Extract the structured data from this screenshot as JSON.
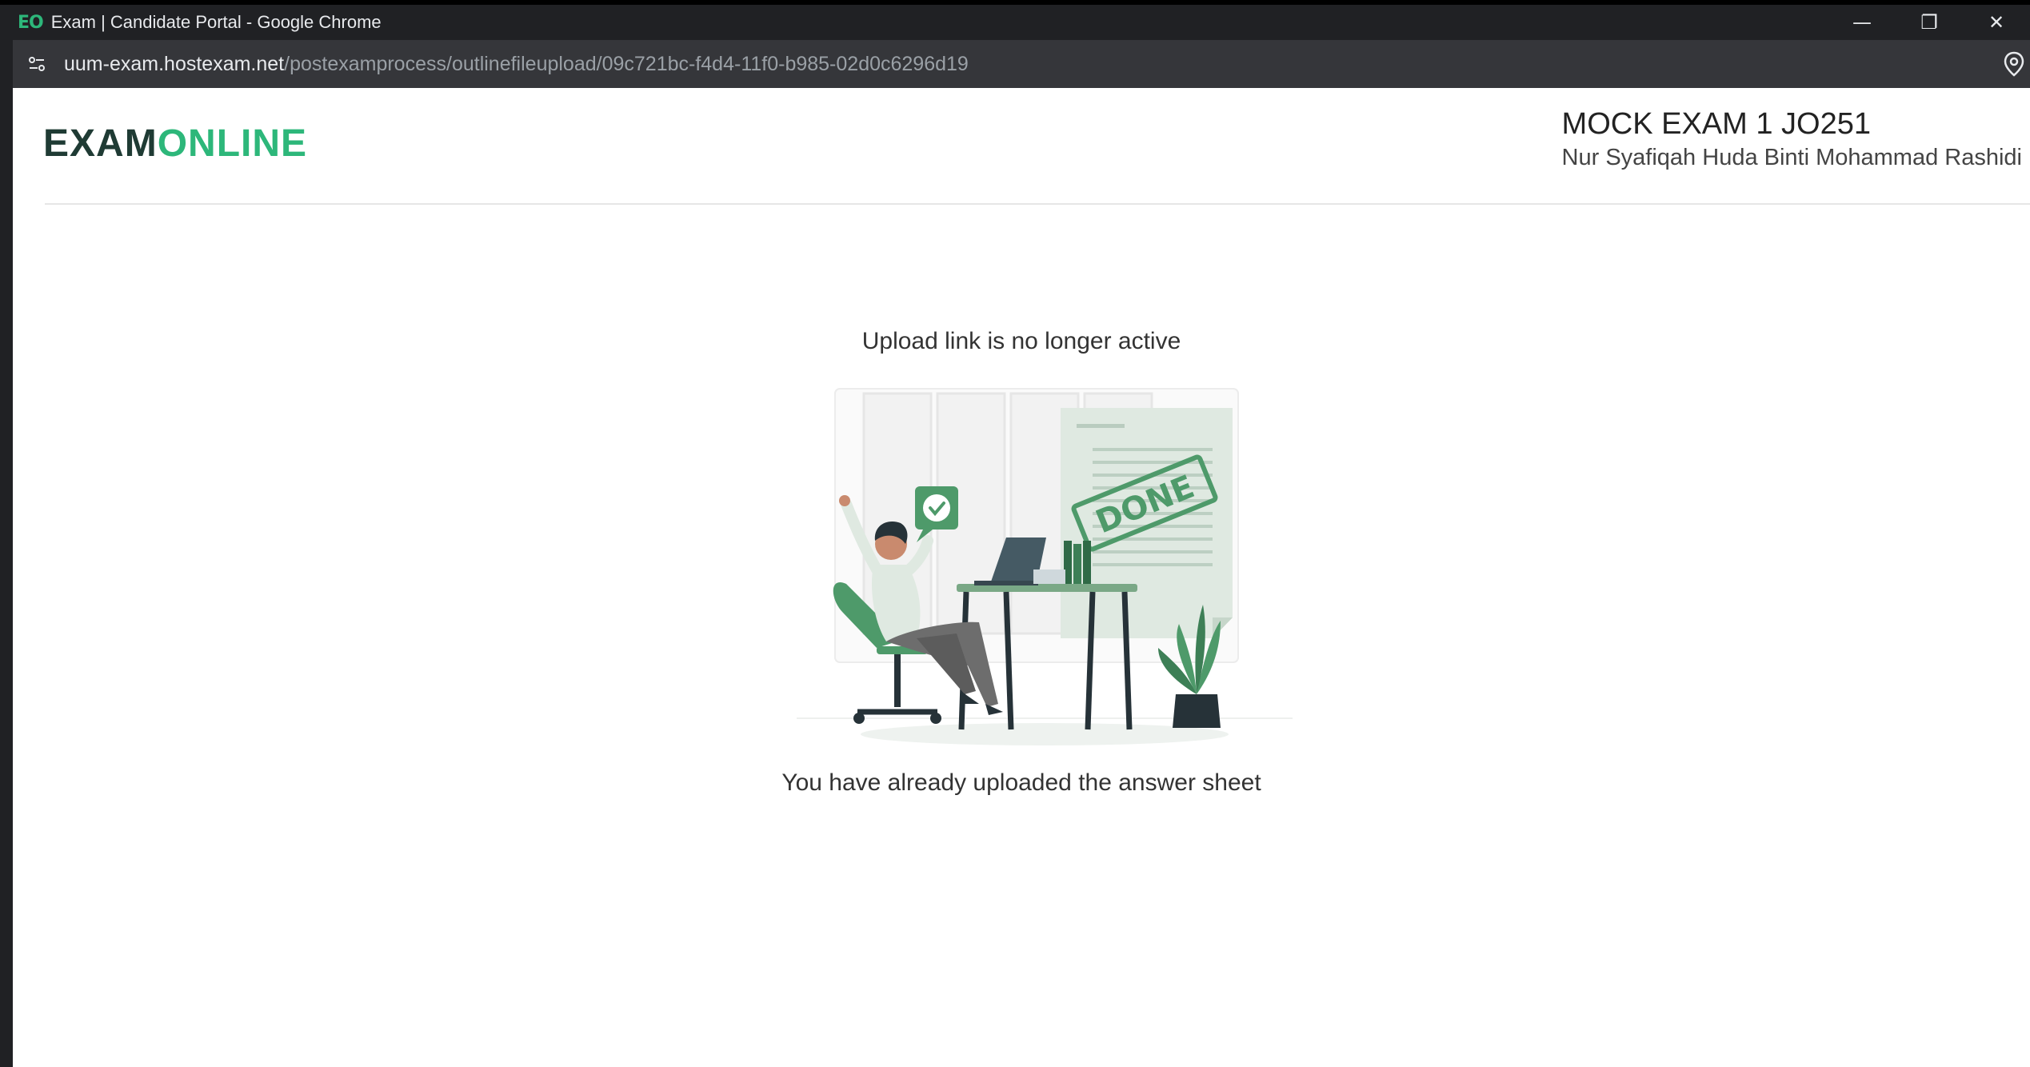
{
  "browser": {
    "favicon_text": "EO",
    "window_title": "Exam | Candidate Portal - Google Chrome",
    "url_host": "uum-exam.hostexam.net",
    "url_path": "/postexamprocess/outlinefileupload/09c721bc-f4d4-11f0-b985-02d0c6296d19",
    "controls": {
      "minimize": "—",
      "restore": "❐",
      "close": "✕"
    }
  },
  "header": {
    "logo_part1": "EXAM",
    "logo_part2": "ONLINE",
    "exam_title": "MOCK EXAM 1 JO251",
    "candidate_name": "Nur Syafiqah Huda Binti Mohammad Rashidi"
  },
  "main": {
    "status_message": "Upload link is no longer active",
    "stamp_text": "DONE",
    "sub_message": "You have already uploaded the answer sheet"
  },
  "colors": {
    "accent": "#2db77a",
    "illustration_green": "#4e9a6a",
    "illustration_light": "#dfe9e1"
  }
}
